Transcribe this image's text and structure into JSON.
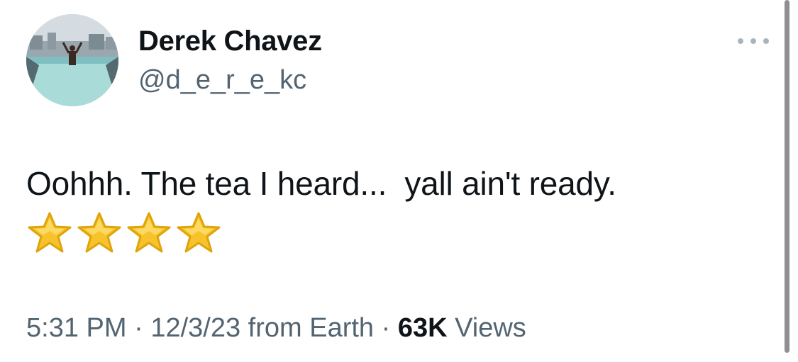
{
  "author": {
    "display_name": "Derek Chavez",
    "handle": "@d_e_r_e_kc",
    "avatar_icon": "avatar-photo-pool"
  },
  "tweet": {
    "text": "Oohhh. The tea I heard...  yall ain't ready.",
    "emoji": [
      "⭐",
      "⭐",
      "⭐",
      "⭐"
    ]
  },
  "meta": {
    "time": "5:31 PM",
    "separator": "·",
    "date": "12/3/23",
    "source": "from Earth",
    "views_count": "63K",
    "views_label": "Views"
  },
  "icons": {
    "more": "more-horizontal-icon",
    "star": "star-emoji-icon"
  },
  "colors": {
    "name": "#0f1419",
    "secondary": "#536471",
    "star_fill": "#f7c22b",
    "star_stroke": "#e0a40b"
  }
}
